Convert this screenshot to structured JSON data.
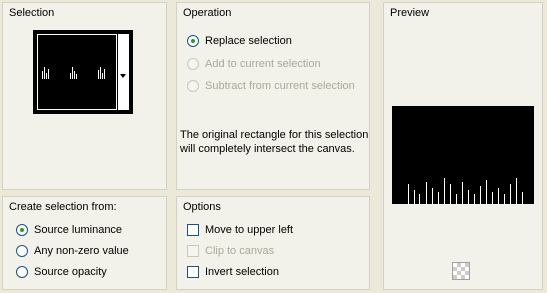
{
  "selection": {
    "title": "Selection"
  },
  "operation": {
    "title": "Operation",
    "options": [
      {
        "label": "Replace selection",
        "checked": true,
        "enabled": true
      },
      {
        "label": "Add to current selection",
        "checked": false,
        "enabled": false
      },
      {
        "label": "Subtract from current selection",
        "checked": false,
        "enabled": false
      }
    ],
    "info": "The original rectangle for this selection will completely intersect the canvas."
  },
  "preview": {
    "title": "Preview"
  },
  "create_from": {
    "title": "Create selection from:",
    "options": [
      {
        "label": "Source luminance",
        "checked": true
      },
      {
        "label": "Any non-zero value",
        "checked": false
      },
      {
        "label": "Source opacity",
        "checked": false
      }
    ]
  },
  "options": {
    "title": "Options",
    "items": [
      {
        "label": "Move to upper left",
        "checked": false,
        "enabled": true
      },
      {
        "label": "Clip to canvas",
        "checked": false,
        "enabled": false
      },
      {
        "label": "Invert selection",
        "checked": false,
        "enabled": true
      }
    ]
  },
  "colors": {
    "panel_bg": "#f2f1ea",
    "dialog_bg": "#ece9d8",
    "radio_dot": "#21a121",
    "disabled_text": "#aca899"
  },
  "icons": {
    "preview_toggle": "transparency-checkerboard-icon",
    "dropdown": "chevron-down-icon"
  }
}
